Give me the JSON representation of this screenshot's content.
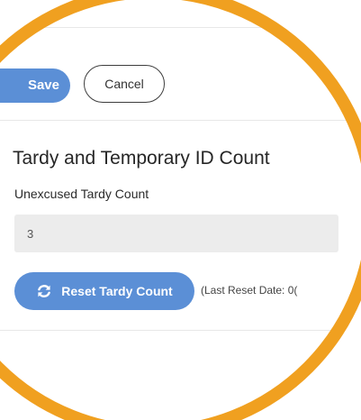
{
  "toolbar": {
    "primary_label": "Save",
    "cancel_label": "Cancel"
  },
  "section": {
    "title": "Tardy and Temporary ID Count"
  },
  "tardy_field": {
    "label": "Unexcused Tardy Count",
    "value": "3"
  },
  "reset": {
    "button_label": "Reset Tardy Count",
    "icon": "refresh-icon",
    "note": "(Last Reset Date: 0("
  },
  "colors": {
    "accent": "#5b8fd6",
    "ring": "#f0a020",
    "input_bg": "#ececec"
  }
}
